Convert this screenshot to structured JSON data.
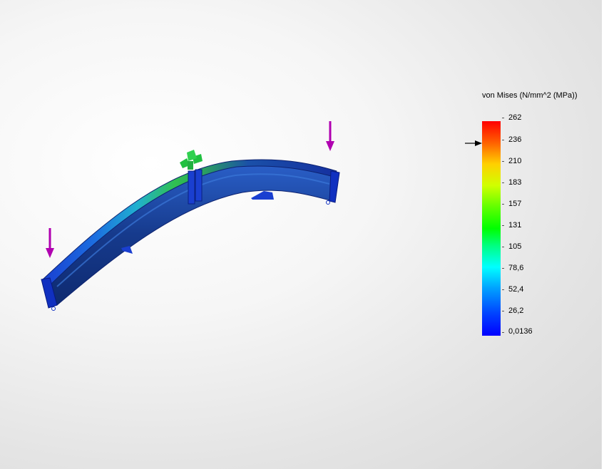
{
  "legend": {
    "title": "von Mises (N/mm^2 (MPa))",
    "tick_labels": [
      "262",
      "236",
      "210",
      "183",
      "157",
      "131",
      "105",
      "78,6",
      "52,4",
      "26,2",
      "0,0136"
    ],
    "colors": {
      "max": "#ff0000",
      "mid": "#00ff00",
      "min": "#0000ff"
    }
  },
  "viewport": {
    "model": "curved-beam",
    "load_arrow_color": "#b000b0",
    "fixture_color": "#20c040"
  }
}
